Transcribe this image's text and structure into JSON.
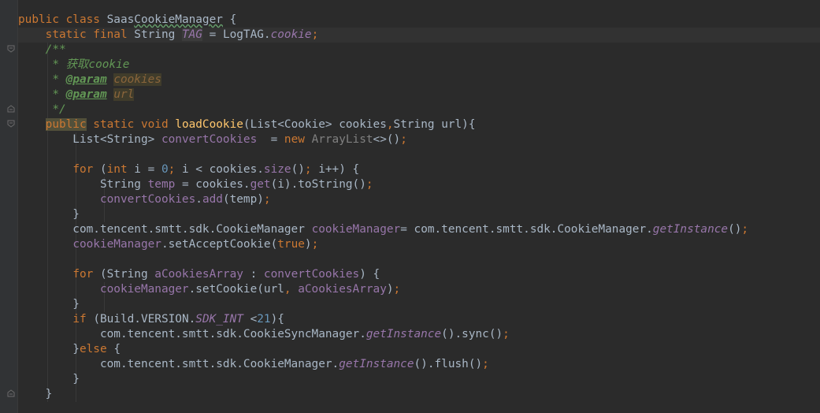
{
  "editor": {
    "language": "java",
    "colors": {
      "background": "#2b2b2b",
      "keyword": "#cc7832",
      "field": "#9876aa",
      "method": "#ffc66d",
      "number": "#6897bb",
      "comment": "#629755",
      "default": "#a9b7c6"
    },
    "lines": [
      {
        "tokens": [
          {
            "t": "public class ",
            "c": "kw"
          },
          {
            "t": "Saas",
            "c": ""
          },
          {
            "t": "CookieManager",
            "c": "typo"
          },
          {
            "t": " {",
            "c": ""
          }
        ]
      },
      {
        "tokens": [
          {
            "t": "    ",
            "c": ""
          },
          {
            "t": "static final ",
            "c": "kw"
          },
          {
            "t": "String ",
            "c": ""
          },
          {
            "t": "TAG",
            "c": "sfld hl-tag"
          },
          {
            "t": " = LogTAG.",
            "c": ""
          },
          {
            "t": "cookie",
            "c": "sfld"
          },
          {
            "t": ";",
            "c": "kw"
          }
        ]
      },
      {
        "tokens": [
          {
            "t": "    /**",
            "c": "doc"
          }
        ]
      },
      {
        "tokens": [
          {
            "t": "     * 获取cookie",
            "c": "doc"
          }
        ]
      },
      {
        "tokens": [
          {
            "t": "     * ",
            "c": "doc"
          },
          {
            "t": "@param",
            "c": "doctag"
          },
          {
            "t": " ",
            "c": "doc"
          },
          {
            "t": "cookies",
            "c": "docparam"
          }
        ]
      },
      {
        "tokens": [
          {
            "t": "     * ",
            "c": "doc"
          },
          {
            "t": "@param",
            "c": "doctag"
          },
          {
            "t": " ",
            "c": "doc"
          },
          {
            "t": "url",
            "c": "docparam"
          }
        ]
      },
      {
        "tokens": [
          {
            "t": "     */",
            "c": "doc"
          }
        ]
      },
      {
        "tokens": [
          {
            "t": "    ",
            "c": ""
          },
          {
            "t": "public",
            "c": "kw hl-kw"
          },
          {
            "t": " static void ",
            "c": "kw"
          },
          {
            "t": "loadCookie",
            "c": "meth"
          },
          {
            "t": "(List<Cookie> cookies",
            "c": ""
          },
          {
            "t": ",",
            "c": "kw"
          },
          {
            "t": "String url){",
            "c": ""
          }
        ]
      },
      {
        "tokens": [
          {
            "t": "        List<String> ",
            "c": ""
          },
          {
            "t": "convertCookies",
            "c": "fld"
          },
          {
            "t": "  = ",
            "c": ""
          },
          {
            "t": "new ",
            "c": "kw"
          },
          {
            "t": "ArrayList",
            "c": "gray"
          },
          {
            "t": "<>()",
            "c": ""
          },
          {
            "t": ";",
            "c": "kw"
          }
        ]
      },
      {
        "tokens": []
      },
      {
        "tokens": [
          {
            "t": "        ",
            "c": ""
          },
          {
            "t": "for ",
            "c": "kw"
          },
          {
            "t": "(",
            "c": ""
          },
          {
            "t": "int ",
            "c": "kw"
          },
          {
            "t": "i = ",
            "c": ""
          },
          {
            "t": "0",
            "c": "num"
          },
          {
            "t": "; ",
            "c": "kw"
          },
          {
            "t": "i < cookies.",
            "c": ""
          },
          {
            "t": "size",
            "c": "fld"
          },
          {
            "t": "()",
            "c": ""
          },
          {
            "t": "; ",
            "c": "kw"
          },
          {
            "t": "i++) {",
            "c": ""
          }
        ]
      },
      {
        "tokens": [
          {
            "t": "            String ",
            "c": ""
          },
          {
            "t": "temp",
            "c": "fld"
          },
          {
            "t": " = cookies.",
            "c": ""
          },
          {
            "t": "get",
            "c": "fld"
          },
          {
            "t": "(i).toString()",
            "c": ""
          },
          {
            "t": ";",
            "c": "kw"
          }
        ]
      },
      {
        "tokens": [
          {
            "t": "            ",
            "c": ""
          },
          {
            "t": "convertCookies",
            "c": "fld"
          },
          {
            "t": ".",
            "c": ""
          },
          {
            "t": "add",
            "c": "fld"
          },
          {
            "t": "(temp)",
            "c": ""
          },
          {
            "t": ";",
            "c": "kw"
          }
        ]
      },
      {
        "tokens": [
          {
            "t": "        }",
            "c": ""
          }
        ]
      },
      {
        "tokens": [
          {
            "t": "        com.tencent.smtt.sdk.CookieManager ",
            "c": ""
          },
          {
            "t": "cookieManager",
            "c": "fld"
          },
          {
            "t": "= com.tencent.smtt.sdk.CookieManager.",
            "c": ""
          },
          {
            "t": "getInstance",
            "c": "sfld"
          },
          {
            "t": "()",
            "c": ""
          },
          {
            "t": ";",
            "c": "kw"
          }
        ]
      },
      {
        "tokens": [
          {
            "t": "        ",
            "c": ""
          },
          {
            "t": "cookieManager",
            "c": "fld"
          },
          {
            "t": ".setAcceptCookie(",
            "c": ""
          },
          {
            "t": "true",
            "c": "kw"
          },
          {
            "t": ")",
            "c": ""
          },
          {
            "t": ";",
            "c": "kw"
          }
        ]
      },
      {
        "tokens": []
      },
      {
        "tokens": [
          {
            "t": "        ",
            "c": ""
          },
          {
            "t": "for ",
            "c": "kw"
          },
          {
            "t": "(String ",
            "c": ""
          },
          {
            "t": "aCookiesArray",
            "c": "fld"
          },
          {
            "t": " : ",
            "c": ""
          },
          {
            "t": "convertCookies",
            "c": "fld"
          },
          {
            "t": ") {",
            "c": ""
          }
        ]
      },
      {
        "tokens": [
          {
            "t": "            ",
            "c": ""
          },
          {
            "t": "cookieManager",
            "c": "fld"
          },
          {
            "t": ".setCookie(url",
            "c": ""
          },
          {
            "t": ", ",
            "c": "kw"
          },
          {
            "t": "aCookiesArray",
            "c": "fld"
          },
          {
            "t": ")",
            "c": ""
          },
          {
            "t": ";",
            "c": "kw"
          }
        ]
      },
      {
        "tokens": [
          {
            "t": "        }",
            "c": ""
          }
        ]
      },
      {
        "tokens": [
          {
            "t": "        ",
            "c": ""
          },
          {
            "t": "if ",
            "c": "kw"
          },
          {
            "t": "(Build.VERSION.",
            "c": ""
          },
          {
            "t": "SDK_INT",
            "c": "sfld"
          },
          {
            "t": " <",
            "c": ""
          },
          {
            "t": "21",
            "c": "num"
          },
          {
            "t": "){",
            "c": ""
          }
        ]
      },
      {
        "tokens": [
          {
            "t": "            com.tencent.smtt.sdk.CookieSyncManager.",
            "c": ""
          },
          {
            "t": "getInstance",
            "c": "sfld"
          },
          {
            "t": "().sync()",
            "c": ""
          },
          {
            "t": ";",
            "c": "kw"
          }
        ]
      },
      {
        "tokens": [
          {
            "t": "        }",
            "c": ""
          },
          {
            "t": "else ",
            "c": "kw"
          },
          {
            "t": "{",
            "c": ""
          }
        ]
      },
      {
        "tokens": [
          {
            "t": "            com.tencent.smtt.sdk.CookieManager.",
            "c": ""
          },
          {
            "t": "getInstance",
            "c": "sfld"
          },
          {
            "t": "().flush()",
            "c": ""
          },
          {
            "t": ";",
            "c": "kw"
          }
        ]
      },
      {
        "tokens": [
          {
            "t": "        }",
            "c": ""
          }
        ]
      },
      {
        "tokens": [
          {
            "t": "    }",
            "c": ""
          }
        ]
      }
    ]
  }
}
